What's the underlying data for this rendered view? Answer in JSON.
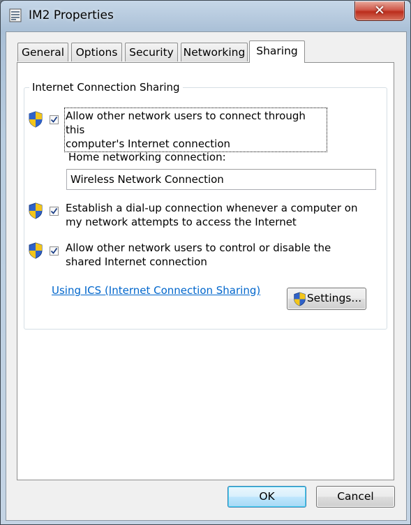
{
  "window": {
    "title": "IM2 Properties",
    "close_glyph": "✕",
    "app_icon": "network-properties-icon"
  },
  "tabs": [
    {
      "label": "General",
      "active": false
    },
    {
      "label": "Options",
      "active": false
    },
    {
      "label": "Security",
      "active": false
    },
    {
      "label": "Networking",
      "active": false
    },
    {
      "label": "Sharing",
      "active": true
    }
  ],
  "sharing": {
    "group_title": "Internet Connection Sharing",
    "options": [
      {
        "line1": "Allow other network users to connect through this",
        "line2": "computer's Internet connection",
        "checked": true,
        "icon": "uac-shield-icon"
      },
      {
        "line1": "Establish a dial-up connection whenever a computer on",
        "line2": "my network attempts to access the Internet",
        "checked": true,
        "icon": "uac-shield-icon"
      },
      {
        "line1": "Allow other network users to control or disable the",
        "line2": "shared Internet connection",
        "checked": true,
        "icon": "uac-shield-icon"
      }
    ],
    "home_label": "Home networking connection:",
    "home_value": "Wireless Network Connection",
    "link_text": "Using ICS (Internet Connection Sharing)",
    "settings_label": "Settings..."
  },
  "footer": {
    "ok_label": "OK",
    "cancel_label": "Cancel"
  },
  "colors": {
    "link": "#0066cc",
    "close_button": "#c7402d",
    "default_button": "#bee6fd",
    "shield_blue": "#2f62c9",
    "shield_yellow": "#f3c51a"
  }
}
